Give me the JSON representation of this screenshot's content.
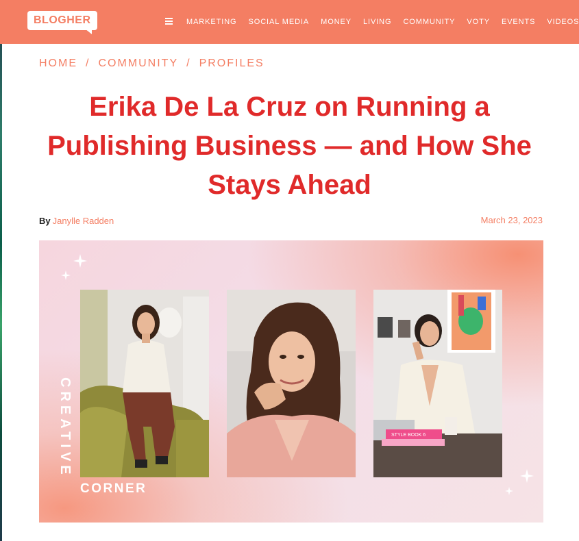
{
  "site": {
    "logo_text": "BLOGHER",
    "nav_items": [
      "MARKETING",
      "SOCIAL MEDIA",
      "MONEY",
      "LIVING",
      "COMMUNITY",
      "VOTY",
      "EVENTS",
      "VIDEOS"
    ]
  },
  "breadcrumb": [
    "HOME",
    "COMMUNITY",
    "PROFILES"
  ],
  "article": {
    "title": "Erika De La Cruz on Running a Publishing Business — and How She Stays Ahead",
    "by_label": "By",
    "author": "Janylle Radden",
    "date": "March 23, 2023"
  },
  "hero": {
    "vertical_text": "CREATIVE",
    "bottom_text": "CORNER",
    "book_label": "STYLE BOOK 6"
  },
  "colors": {
    "brand": "#f47e63",
    "title": "#e02a2a"
  },
  "icons": {
    "menu": "hamburger-icon",
    "sparkle": "sparkle-icon"
  }
}
